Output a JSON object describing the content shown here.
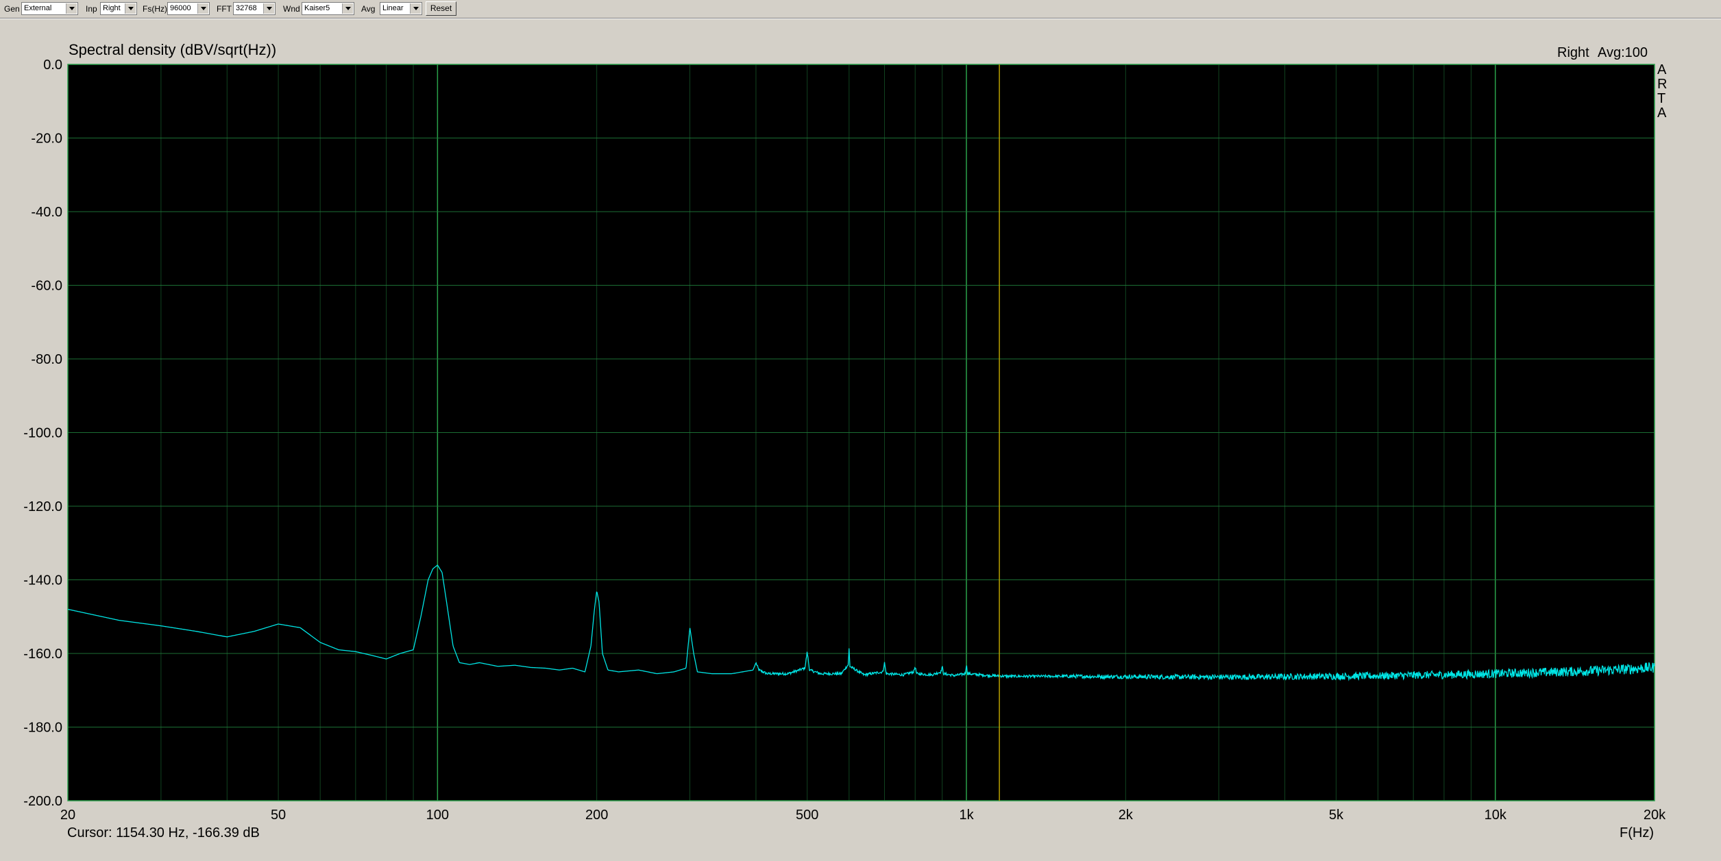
{
  "toolbar": {
    "gen_label": "Gen",
    "gen_value": "External",
    "inp_label": "Inp",
    "inp_value": "Right",
    "fs_label": "Fs(Hz)",
    "fs_value": "96000",
    "fft_label": "FFT",
    "fft_value": "32768",
    "wnd_label": "Wnd",
    "wnd_value": "Kaiser5",
    "avg_label": "Avg",
    "avg_value": "Linear",
    "reset_label": "Reset"
  },
  "header": {
    "channel": "Right",
    "avg_info": "Avg:100",
    "logo_letters": [
      "A",
      "R",
      "T",
      "A"
    ]
  },
  "cursor_readout": "Cursor: 1154.30 Hz, -166.39 dB",
  "colors": {
    "plot_bg": "#000000",
    "grid": "#1f7a3a",
    "trace": "#00e5e5",
    "cursor": "#b8a000",
    "panel_bg": "#d4d0c8"
  },
  "chart_data": {
    "type": "line",
    "title": "Spectral density (dBV/sqrt(Hz))",
    "xlabel": "F(Hz)",
    "x_scale": "log",
    "xlim": [
      20,
      20000
    ],
    "ylim": [
      -200,
      0
    ],
    "grid": true,
    "x_tick_labels": [
      {
        "value": 20,
        "label": "20"
      },
      {
        "value": 50,
        "label": "50"
      },
      {
        "value": 100,
        "label": "100"
      },
      {
        "value": 200,
        "label": "200"
      },
      {
        "value": 500,
        "label": "500"
      },
      {
        "value": 1000,
        "label": "1k"
      },
      {
        "value": 2000,
        "label": "2k"
      },
      {
        "value": 5000,
        "label": "5k"
      },
      {
        "value": 10000,
        "label": "10k"
      },
      {
        "value": 20000,
        "label": "20k"
      }
    ],
    "y_tick_labels": [
      "0.0",
      "-20.0",
      "-40.0",
      "-60.0",
      "-80.0",
      "-100.0",
      "-120.0",
      "-140.0",
      "-160.0",
      "-180.0",
      "-200.0"
    ],
    "y_ticks": [
      0,
      -20,
      -40,
      -60,
      -80,
      -100,
      -120,
      -140,
      -160,
      -180,
      -200
    ],
    "cursor_hz": 1154.3,
    "series": [
      {
        "x": [
          20,
          25,
          30,
          35,
          40,
          45,
          50,
          55,
          60,
          65,
          70,
          75,
          80,
          85,
          90,
          93,
          96,
          98,
          100,
          102,
          104,
          107,
          110,
          115,
          120,
          130,
          140,
          150,
          160,
          170,
          180,
          190,
          195,
          198,
          200,
          202,
          205,
          210,
          220,
          240,
          260,
          280,
          295,
          300,
          305,
          310,
          330,
          360,
          395,
          400,
          405,
          420,
          460,
          495,
          500,
          505,
          530,
          580,
          598,
          600,
          602,
          640,
          695,
          700,
          705,
          760,
          795,
          800,
          805,
          860,
          895,
          900,
          905,
          950,
          995,
          1000,
          1005,
          1100,
          1200,
          1400,
          1600,
          1800,
          2000,
          2500,
          3000,
          3500,
          4000,
          5000,
          6000,
          7000,
          8000,
          10000,
          12000,
          14000,
          16000,
          18000,
          20000
        ],
        "y": [
          -148,
          -151,
          -152.5,
          -154,
          -155.5,
          -154,
          -152,
          -153,
          -157,
          -159,
          -159.5,
          -160.5,
          -161.5,
          -160,
          -159,
          -150,
          -140,
          -137,
          -136,
          -138,
          -146,
          -158,
          -162.5,
          -163,
          -162.5,
          -163.5,
          -163.2,
          -163.8,
          -164,
          -164.5,
          -164,
          -165,
          -158,
          -148,
          -143,
          -146,
          -160,
          -164.5,
          -165,
          -164.5,
          -165.5,
          -165,
          -164,
          -153,
          -160,
          -165,
          -165.5,
          -165.5,
          -164.5,
          -162.5,
          -164.5,
          -165.5,
          -165.5,
          -164,
          -159.5,
          -164.5,
          -165.5,
          -165.5,
          -163,
          -158.5,
          -163.5,
          -165.8,
          -165,
          -162.5,
          -165.5,
          -165.8,
          -165,
          -163.5,
          -165.5,
          -165.8,
          -165,
          -163.5,
          -165.5,
          -166,
          -165.5,
          -163,
          -165.5,
          -166,
          -166.2,
          -166.2,
          -166.2,
          -166.3,
          -166.3,
          -166.4,
          -166.4,
          -166.4,
          -166.3,
          -166.2,
          -166.1,
          -165.9,
          -165.8,
          -165.5,
          -165.2,
          -164.9,
          -164.6,
          -164.2,
          -163.8
        ]
      }
    ]
  }
}
